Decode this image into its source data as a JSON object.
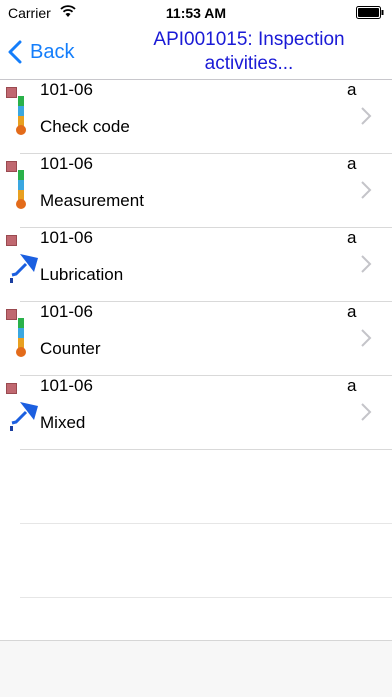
{
  "status": {
    "carrier": "Carrier",
    "time": "11:53 AM",
    "icons": [
      "wifi-icon",
      "battery-icon"
    ]
  },
  "nav": {
    "back_label": "Back",
    "title": "API001015: Inspection activities..."
  },
  "colors": {
    "accent": "#147efb",
    "title": "#1a1ad6",
    "status_square": "#c06870"
  },
  "rows": [
    {
      "code": "101-06",
      "flag": "a",
      "label": "Check code",
      "icon": "thermometer-icon"
    },
    {
      "code": "101-06",
      "flag": "a",
      "label": "Measurement",
      "icon": "thermometer-icon"
    },
    {
      "code": "101-06",
      "flag": "a",
      "label": "Lubrication",
      "icon": "oil-funnel-icon"
    },
    {
      "code": "101-06",
      "flag": "a",
      "label": "Counter",
      "icon": "thermometer-icon"
    },
    {
      "code": "101-06",
      "flag": "a",
      "label": "Mixed",
      "icon": "oil-funnel-icon"
    }
  ]
}
